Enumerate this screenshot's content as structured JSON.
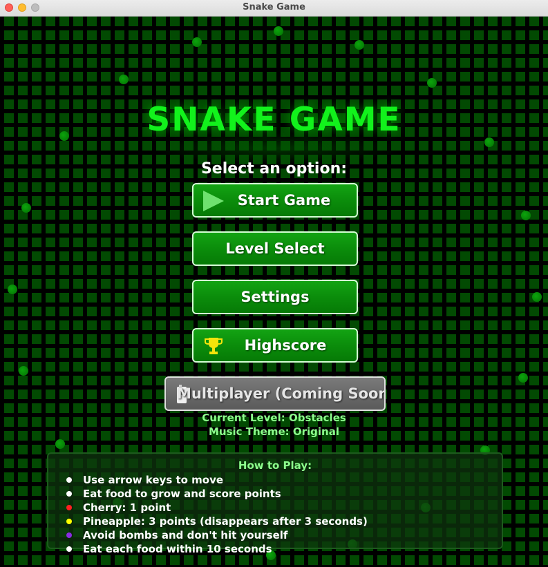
{
  "window": {
    "title": "Snake Game"
  },
  "game": {
    "title": "SNAKE GAME",
    "subtitle": "Select an option:",
    "buttons": {
      "start": "Start Game",
      "level_select": "Level Select",
      "settings": "Settings",
      "highscore": "Highscore",
      "multiplayer": "Multiplayer (Coming Soon)"
    },
    "current_level": "Current Level: Obstacles",
    "music_theme": "Music Theme: Original"
  },
  "how_to_play": {
    "title": "How to Play:",
    "items": [
      {
        "text": "Use arrow keys to move",
        "color": "#ffffff"
      },
      {
        "text": "Eat food to grow and score points",
        "color": "#ffffff"
      },
      {
        "text": "Cherry: 1 point",
        "color": "#ff2020"
      },
      {
        "text": "Pineapple: 3 points (disappears after 3 seconds)",
        "color": "#ffff00"
      },
      {
        "text": "Avoid bombs and don't hit yourself",
        "color": "#8a2be2"
      },
      {
        "text": "Eat each food within 10 seconds",
        "color": "#ffffff"
      }
    ]
  },
  "colors": {
    "accent": "#12f21c",
    "button": "#0b8d0b",
    "disabled_button": "#6a6a6a",
    "info_text": "#8dff8d"
  },
  "icons": {
    "start": "play-icon",
    "highscore": "trophy-icon",
    "multiplayer": "phone-icon"
  }
}
